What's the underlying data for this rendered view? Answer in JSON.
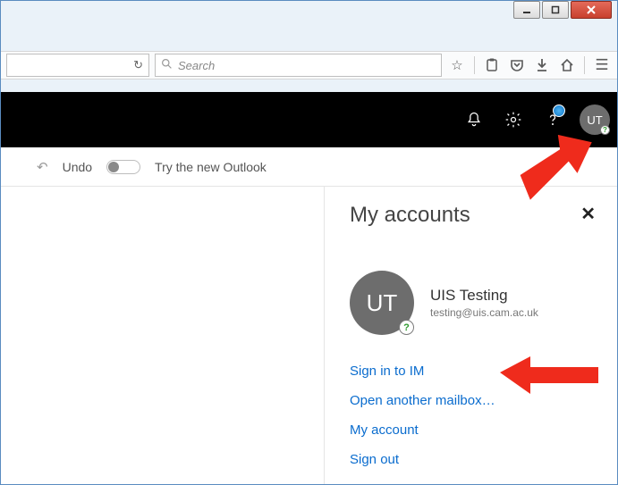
{
  "browser": {
    "search_placeholder": "Search"
  },
  "app_toolbar": {
    "undo_label": "Undo",
    "try_outlook_label": "Try the new Outlook"
  },
  "header": {
    "avatar_initials": "UT"
  },
  "panel": {
    "title": "My accounts",
    "avatar_initials": "UT",
    "display_name": "UIS Testing",
    "email": "testing@uis.cam.ac.uk",
    "links": {
      "sign_in_im": "Sign in to IM",
      "open_mailbox": "Open another mailbox…",
      "my_account": "My account",
      "sign_out": "Sign out"
    }
  }
}
